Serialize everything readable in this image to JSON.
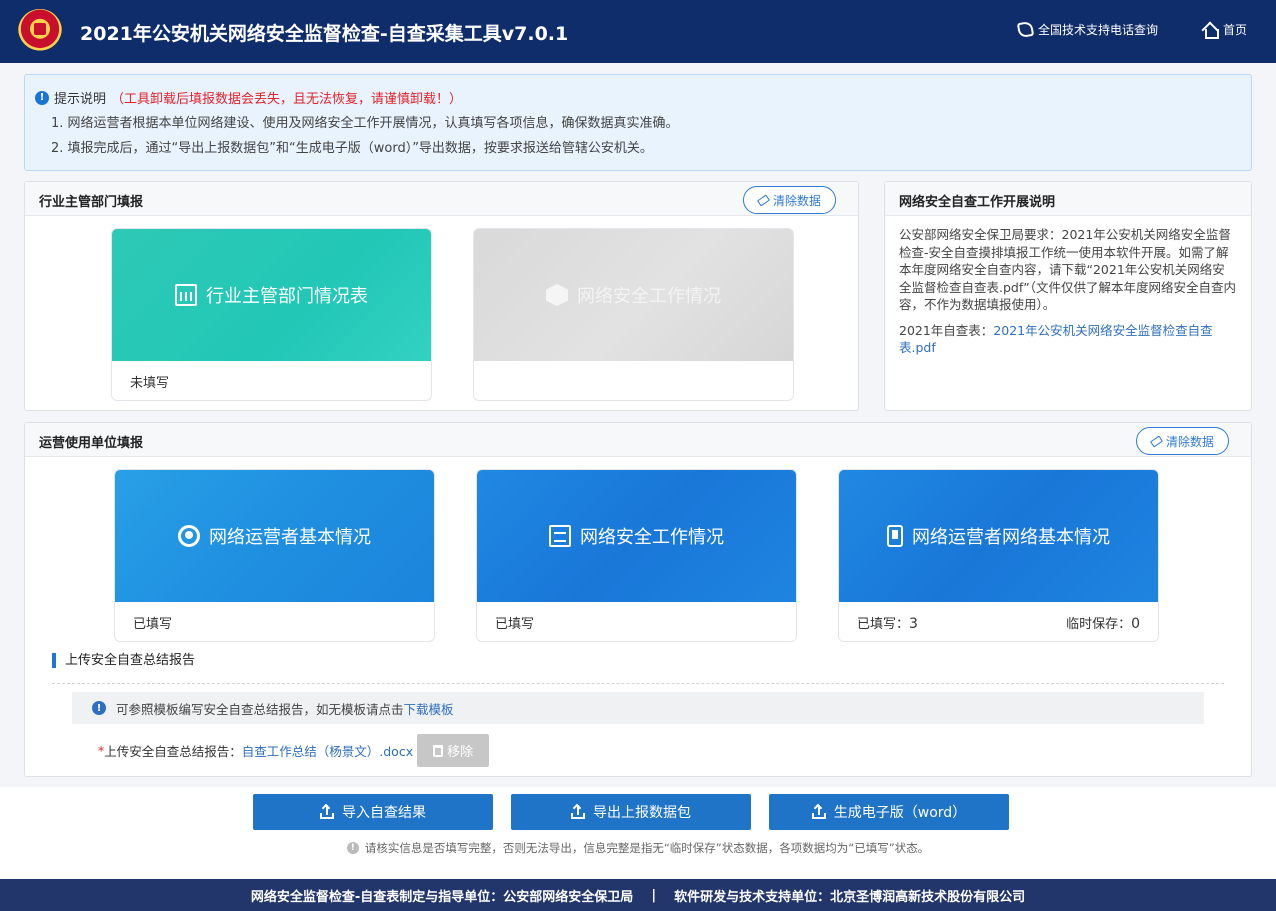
{
  "header": {
    "title": "2021年公安机关网络安全监督检查-自查采集工具v7.0.1",
    "support_phone": "全国技术支持电话查询",
    "home": "首页"
  },
  "notice": {
    "label": "提示说明",
    "warning": "（工具卸载后填报数据会丢失，且无法恢复，请谨慎卸载！）",
    "line1": "1. 网络运营者根据本单位网络建设、使用及网络安全工作开展情况，认真填写各项信息，确保数据真实准确。",
    "line2": "2. 填报完成后，通过“导出上报数据包”和“生成电子版（word）”导出数据，按要求报送给管辖公安机关。"
  },
  "industry": {
    "title": "行业主管部门填报",
    "clear": "清除数据",
    "cards": [
      {
        "label": "行业主管部门情况表",
        "status": "未填写"
      },
      {
        "label": "网络安全工作情况",
        "status": ""
      }
    ]
  },
  "explain": {
    "title": "网络安全自查工作开展说明",
    "paragraph": "公安部网络安全保卫局要求：2021年公安机关网络安全监督检查-安全自查摸排填报工作统一使用本软件开展。如需了解本年度网络安全自查内容，请下载“2021年公安机关网络安全监督检查自查表.pdf”（文件仅供了解本年度网络安全自查内容，不作为数据填报使用）。",
    "file_label": "2021年自查表：",
    "file_link": "2021年公安机关网络安全监督检查自查表.pdf"
  },
  "operator": {
    "title": "运营使用单位填报",
    "clear": "清除数据",
    "cards": [
      {
        "label": "网络运营者基本情况",
        "status": "已填写"
      },
      {
        "label": "网络安全工作情况",
        "status": "已填写"
      },
      {
        "label": "网络运营者网络基本情况",
        "filled_label": "已填写：",
        "filled_count": "3",
        "temp_label": "临时保存：",
        "temp_count": "0"
      }
    ]
  },
  "upload": {
    "section_title": "上传安全自查总结报告",
    "tip": "可参照模板编写安全自查总结报告，如无模板请点击",
    "tip_link": "下载模板",
    "field_label": "上传安全自查总结报告：",
    "file_name": "自查工作总结（杨景文）.docx",
    "remove": "移除"
  },
  "actions": {
    "import": "导入自查结果",
    "export": "导出上报数据包",
    "word": "生成电子版（word）",
    "note": "请核实信息是否填写完整，否则无法导出，信息完整是指无“临时保存”状态数据，各项数据均为“已填写”状态。"
  },
  "footer": {
    "left": "网络安全监督检查-自查表制定与指导单位：公安部网络安全保卫局",
    "separator": "|",
    "right": "软件研发与技术支持单位：北京圣博润高新技术股份有限公司"
  },
  "colors": {
    "header_bg": "#0f2d6b",
    "teal": "#22c7b6",
    "blue": "#1f8fe0",
    "button_blue": "#1f74c8",
    "warning_red": "#e0242a"
  }
}
